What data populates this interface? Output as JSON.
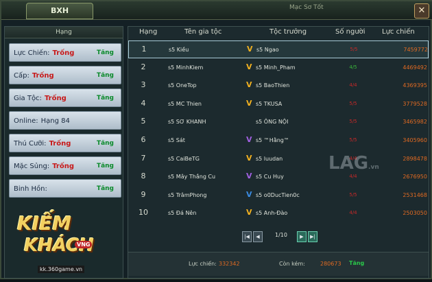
{
  "window": {
    "title": "BXH",
    "top_text": "Mạc Sơ Tốt",
    "close_icon": "close-icon"
  },
  "left": {
    "header": "Hạng",
    "stats": [
      {
        "label": "Lực Chiến:",
        "value": "Trống",
        "up": "Tăng"
      },
      {
        "label": "Cấp:",
        "value": "Trống",
        "up": "Tăng"
      },
      {
        "label": "Gia Tộc:",
        "value": "Trống",
        "up": "Tăng"
      },
      {
        "label": "Online:",
        "value": "Hạng 84",
        "up": ""
      },
      {
        "label": "Thú Cưỡi:",
        "value": "Trống",
        "up": "Tăng"
      },
      {
        "label": "Mặc Sủng:",
        "value": "Trống",
        "up": "Tăng"
      },
      {
        "label": "Binh Hồn:",
        "value": "",
        "up": "Tăng"
      }
    ]
  },
  "table": {
    "headers": [
      "Hạng",
      "Tên gia tộc",
      "Tộc trưởng",
      "Số người",
      "Lực chiến"
    ],
    "rows": [
      {
        "rank": "1",
        "guild": "s5 Kiều",
        "leader": "s5 Ngao",
        "members": "5/5",
        "power": "7459772"
      },
      {
        "rank": "2",
        "guild": "s5 MinhKiem",
        "leader": "s5 Minh_Pham",
        "members": "4/5",
        "power": "4469492"
      },
      {
        "rank": "3",
        "guild": "s5 OneTop",
        "leader": "s5 BaoThien",
        "members": "4/4",
        "power": "4369395"
      },
      {
        "rank": "4",
        "guild": "s5 MC Thien",
        "leader": "s5 TKUSA",
        "members": "5/5",
        "power": "3779528"
      },
      {
        "rank": "5",
        "guild": "s5 SƠ KHANH",
        "leader": "s5 ÔNG NỘI",
        "members": "5/5",
        "power": "3465982"
      },
      {
        "rank": "6",
        "guild": "s5 Sát",
        "leader": "s5 ™Hằng™",
        "members": "5/5",
        "power": "3405960"
      },
      {
        "rank": "7",
        "guild": "s5 CaiBeTG",
        "leader": "s5 luudan",
        "members": "4/4",
        "power": "2898478"
      },
      {
        "rank": "8",
        "guild": "s5 Mây Thắng Cu",
        "leader": "s5 Cu Huy",
        "members": "4/4",
        "power": "2676950"
      },
      {
        "rank": "9",
        "guild": "s5 TrâmPhong",
        "leader": "s5 o0DucTien0c",
        "members": "5/5",
        "power": "2531468"
      },
      {
        "rank": "10",
        "guild": "s5 Đá Nên",
        "leader": "s5 Anh-Đào",
        "members": "4/4",
        "power": "2503050"
      }
    ],
    "page": "1/10"
  },
  "footer": {
    "power_label": "Lực chiến:",
    "power_value": "332342",
    "remain_label": "Còn kém:",
    "remain_value": "280673",
    "up_label": "Tăng"
  },
  "logo": {
    "line1": "KIẾM",
    "line2": "KHÁCH",
    "badge": "VNG",
    "url": "kk.360game.vn"
  },
  "watermark": {
    "text": "LAG",
    "suffix": ".vn"
  },
  "colors": {
    "red_value": "#c81818",
    "green_up": "#0a8a2a",
    "power_orange": "#e06a22",
    "full_members": "#c82828",
    "partial_members": "#3ab83a"
  }
}
